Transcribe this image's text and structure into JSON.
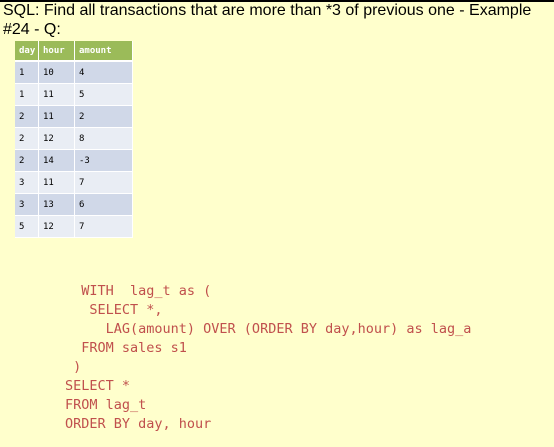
{
  "slide": {
    "title": "SQL: Find all transactions that are more than *3 of previous one - Example #24 - Q:"
  },
  "table": {
    "headers": [
      "day",
      "hour",
      "amount"
    ],
    "rows": [
      [
        "1",
        "10",
        "4"
      ],
      [
        "1",
        "11",
        "5"
      ],
      [
        "2",
        "11",
        "2"
      ],
      [
        "2",
        "12",
        "8"
      ],
      [
        "2",
        "14",
        "-3"
      ],
      [
        "3",
        "11",
        "7"
      ],
      [
        "3",
        "13",
        "6"
      ],
      [
        "5",
        "12",
        "7"
      ]
    ]
  },
  "code": {
    "lines": [
      "  WITH  lag_t as (",
      "   SELECT *,",
      "     LAG(amount) OVER (ORDER BY day,hour) as lag_a",
      "  FROM sales s1",
      " )",
      "SELECT *",
      "FROM lag_t",
      "ORDER BY day, hour"
    ]
  },
  "colors": {
    "background": "#ffffcc",
    "table_header": "#9bbb59",
    "row_dark": "#d0d8e8",
    "row_light": "#e9edf4",
    "code_text": "#c0504d"
  }
}
